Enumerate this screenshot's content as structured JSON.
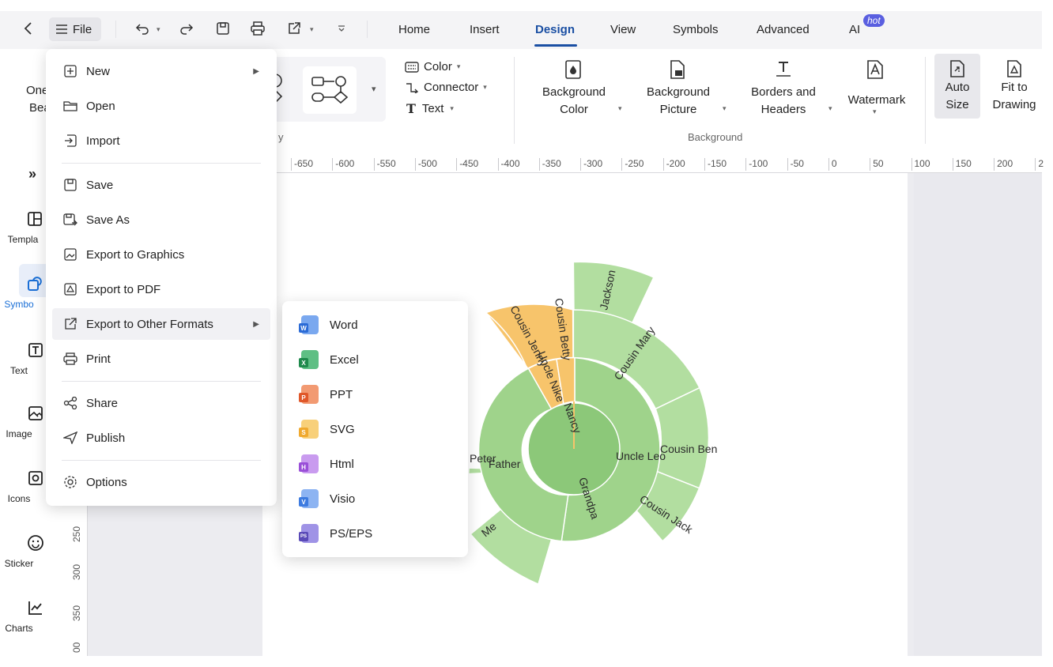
{
  "titlebar": {
    "file_label": "File",
    "tabs": [
      {
        "label": "Home"
      },
      {
        "label": "Insert"
      },
      {
        "label": "Design",
        "active": true
      },
      {
        "label": "View"
      },
      {
        "label": "Symbols"
      },
      {
        "label": "Advanced"
      },
      {
        "label": "AI"
      }
    ],
    "hot_badge": "hot"
  },
  "ribbon": {
    "one_beautify_line1": "One",
    "one_beautify_line2": "Bea",
    "color_label": "Color",
    "connector_label": "Connector",
    "text_label": "Text",
    "background_color": [
      "Background",
      "Color"
    ],
    "background_picture": [
      "Background",
      "Picture"
    ],
    "borders_headers": [
      "Borders and",
      "Headers"
    ],
    "watermark": "Watermark",
    "auto_size": [
      "Auto",
      "Size"
    ],
    "fit_to_drawing": [
      "Fit to",
      "Drawing"
    ],
    "group_background": "Background",
    "group_cut": "y"
  },
  "leftbar": {
    "items": [
      {
        "label": "Templa",
        "icon": "template-icon"
      },
      {
        "label": "Symbo",
        "icon": "symbols-icon"
      },
      {
        "label": "Text",
        "icon": "text-icon"
      },
      {
        "label": "Image",
        "icon": "image-icon"
      },
      {
        "label": "Icons",
        "icon": "icons-icon"
      },
      {
        "label": "Sticker",
        "icon": "sticker-icon"
      },
      {
        "label": "Charts",
        "icon": "charts-icon"
      }
    ]
  },
  "hruler": [
    "-650",
    "-600",
    "-550",
    "-500",
    "-450",
    "-400",
    "-350",
    "-300",
    "-250",
    "-200",
    "-150",
    "-100",
    "-50",
    "0",
    "50",
    "100",
    "150",
    "200",
    "2"
  ],
  "vruler": [
    "250",
    "300",
    "350",
    "00"
  ],
  "file_menu": {
    "items": [
      {
        "label": "New",
        "icon": "new-icon",
        "submenu": true
      },
      {
        "label": "Open",
        "icon": "folder-icon"
      },
      {
        "label": "Import",
        "icon": "import-icon"
      },
      {
        "label": "Save",
        "icon": "save-icon"
      },
      {
        "label": "Save As",
        "icon": "save-as-icon"
      },
      {
        "label": "Export to Graphics",
        "icon": "export-graphics-icon"
      },
      {
        "label": "Export to PDF",
        "icon": "export-pdf-icon"
      },
      {
        "label": "Export to Other Formats",
        "icon": "export-other-icon",
        "submenu": true,
        "highlighted": true
      },
      {
        "label": "Print",
        "icon": "print-icon"
      },
      {
        "label": "Share",
        "icon": "share-icon"
      },
      {
        "label": "Publish",
        "icon": "publish-icon"
      },
      {
        "label": "Options",
        "icon": "gear-icon"
      }
    ]
  },
  "export_submenu": {
    "items": [
      {
        "label": "Word",
        "badge": "W",
        "color": "#2b6bd6"
      },
      {
        "label": "Excel",
        "badge": "X",
        "color": "#1f8a4c"
      },
      {
        "label": "PPT",
        "badge": "P",
        "color": "#e0582a"
      },
      {
        "label": "SVG",
        "badge": "S",
        "color": "#f0a92e"
      },
      {
        "label": "Html",
        "badge": "H",
        "color": "#9a4fd8"
      },
      {
        "label": "Visio",
        "badge": "V",
        "color": "#3d7be0"
      },
      {
        "label": "PS/EPS",
        "badge": "PS",
        "color": "#5a4ab8"
      }
    ]
  },
  "sunburst_labels": {
    "center": "Grandpa",
    "ring1": [
      "Uncle Leo",
      "Father",
      "Uncle Nike",
      "Nancy"
    ],
    "ring2": [
      "Cousin Mary",
      "Cousin Ben",
      "Cousin Jack",
      "Me",
      "Peter",
      "Cousin Jenny",
      "Cousin Betty"
    ],
    "ring3": [
      "Jackson"
    ]
  },
  "colors": {
    "accent": "#1a4fa3",
    "green_dark": "#8cc879",
    "green_mid": "#9fd38b",
    "green_light": "#b2dea0",
    "orange": "#f7c46b"
  }
}
